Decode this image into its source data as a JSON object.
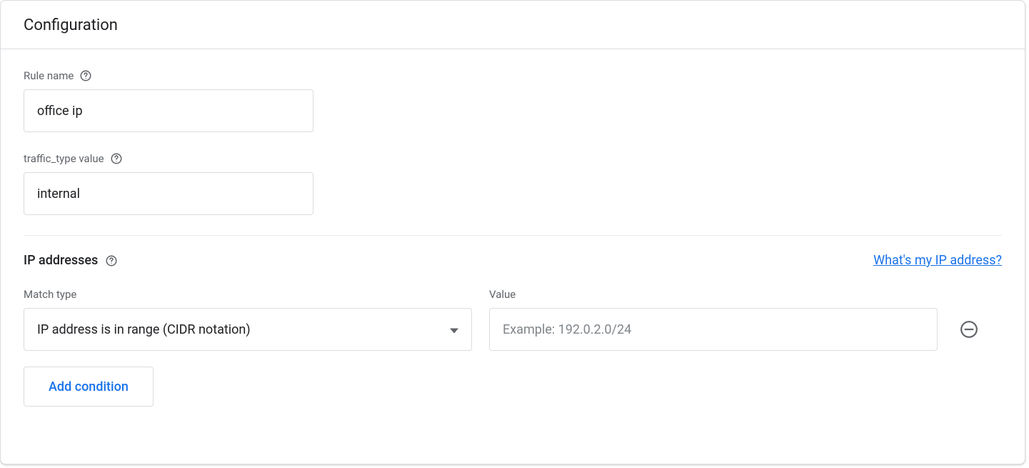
{
  "header": {
    "title": "Configuration"
  },
  "ruleName": {
    "label": "Rule name",
    "value": "office ip"
  },
  "trafficType": {
    "label": "traffic_type value",
    "value": "internal"
  },
  "ipSection": {
    "title": "IP addresses",
    "whatsMyIpLink": "What's my IP address?",
    "matchTypeLabel": "Match type",
    "valueLabel": "Value",
    "row": {
      "matchTypeSelected": "IP address is in range (CIDR notation)",
      "valuePlaceholder": "Example: 192.0.2.0/24",
      "value": ""
    },
    "addConditionLabel": "Add condition"
  }
}
